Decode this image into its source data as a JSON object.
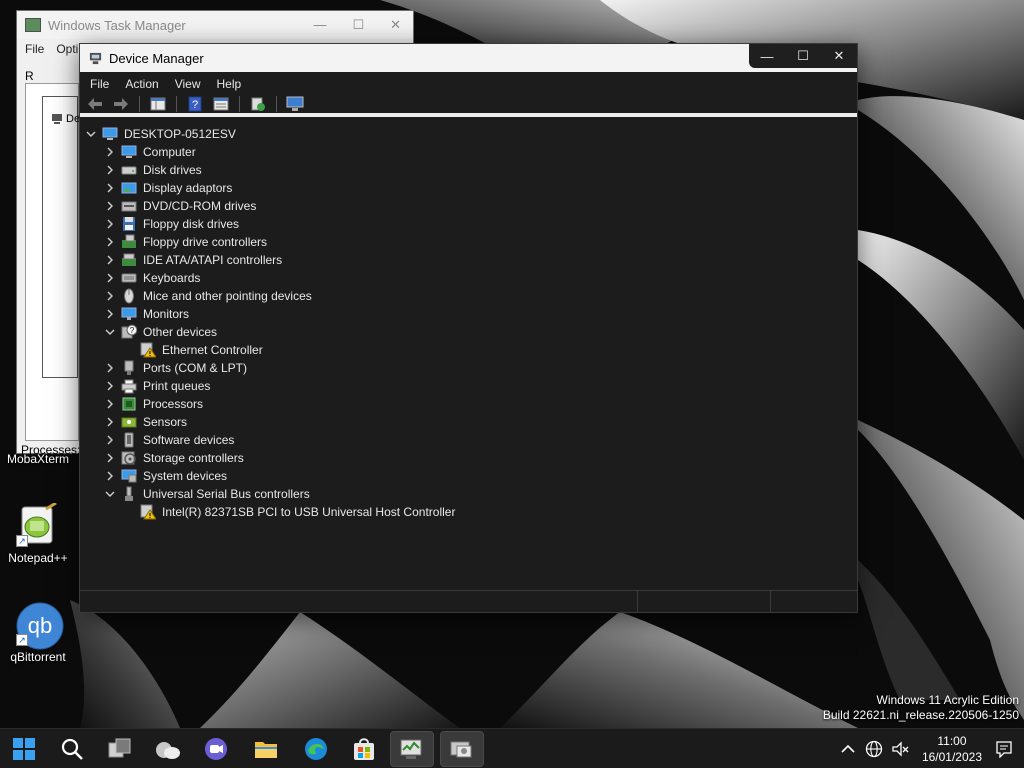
{
  "desktop": {
    "icons": [
      {
        "label": "MobaXterm"
      },
      {
        "label": "Notepad++"
      },
      {
        "label": "qBittorrent"
      }
    ],
    "qbittorrent_glyph_text": "qb"
  },
  "task_manager": {
    "title": "Windows Task Manager",
    "menu": [
      "File",
      "Opti"
    ],
    "stub_label": "R",
    "tree_item_label": "De",
    "status_text": "Processes:"
  },
  "device_manager": {
    "title": "Device Manager",
    "menu": [
      "File",
      "Action",
      "View",
      "Help"
    ],
    "root_label": "DESKTOP-0512ESV",
    "categories": [
      {
        "label": "Computer",
        "expanded": false,
        "icon": "computer-icon"
      },
      {
        "label": "Disk drives",
        "expanded": false,
        "icon": "disk-drive-icon"
      },
      {
        "label": "Display adaptors",
        "expanded": false,
        "icon": "display-adapter-icon"
      },
      {
        "label": "DVD/CD-ROM drives",
        "expanded": false,
        "icon": "dvd-drive-icon"
      },
      {
        "label": "Floppy disk drives",
        "expanded": false,
        "icon": "floppy-disk-icon"
      },
      {
        "label": "Floppy drive controllers",
        "expanded": false,
        "icon": "floppy-controller-icon"
      },
      {
        "label": "IDE ATA/ATAPI controllers",
        "expanded": false,
        "icon": "ide-controller-icon"
      },
      {
        "label": "Keyboards",
        "expanded": false,
        "icon": "keyboard-icon"
      },
      {
        "label": "Mice and other pointing devices",
        "expanded": false,
        "icon": "mouse-icon"
      },
      {
        "label": "Monitors",
        "expanded": false,
        "icon": "monitor-icon"
      },
      {
        "label": "Other devices",
        "expanded": true,
        "icon": "unknown-device-icon",
        "children": [
          {
            "label": "Ethernet Controller",
            "icon": "warning-device-icon"
          }
        ]
      },
      {
        "label": "Ports (COM & LPT)",
        "expanded": false,
        "icon": "port-icon"
      },
      {
        "label": "Print queues",
        "expanded": false,
        "icon": "printer-icon"
      },
      {
        "label": "Processors",
        "expanded": false,
        "icon": "processor-icon"
      },
      {
        "label": "Sensors",
        "expanded": false,
        "icon": "sensor-icon"
      },
      {
        "label": "Software devices",
        "expanded": false,
        "icon": "software-device-icon"
      },
      {
        "label": "Storage controllers",
        "expanded": false,
        "icon": "storage-controller-icon"
      },
      {
        "label": "System devices",
        "expanded": false,
        "icon": "system-device-icon"
      },
      {
        "label": "Universal Serial Bus controllers",
        "expanded": true,
        "icon": "usb-icon",
        "children": [
          {
            "label": "Intel(R) 82371SB PCI to USB Universal Host Controller",
            "icon": "warning-device-icon"
          }
        ]
      }
    ]
  },
  "watermark": {
    "line1": "Windows 11 Acrylic Edition",
    "line2": "Build 22621.ni_release.220506-1250"
  },
  "taskbar": {
    "time": "11:00",
    "date": "16/01/2023"
  },
  "colors": {
    "accent_blue": "#0078d4",
    "warning_yellow": "#f5c400"
  }
}
